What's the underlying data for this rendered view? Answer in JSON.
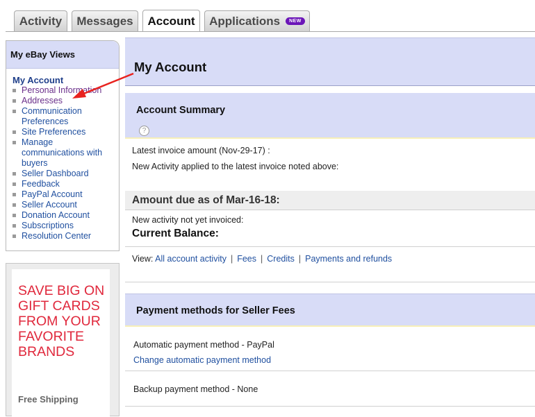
{
  "tabs": [
    {
      "label": "Activity"
    },
    {
      "label": "Messages"
    },
    {
      "label": "Account"
    },
    {
      "label": "Applications",
      "badge": "NEW"
    }
  ],
  "sidebar": {
    "title": "My eBay Views",
    "section": "My Account",
    "items": [
      {
        "label": "Personal Information"
      },
      {
        "label": "Addresses"
      },
      {
        "label": "Communication Preferences"
      },
      {
        "label": "Site Preferences"
      },
      {
        "label": "Manage communications with buyers"
      },
      {
        "label": "Seller Dashboard"
      },
      {
        "label": "Feedback"
      },
      {
        "label": "PayPal Account"
      },
      {
        "label": "Seller Account"
      },
      {
        "label": "Donation Account"
      },
      {
        "label": "Subscriptions"
      },
      {
        "label": "Resolution Center"
      }
    ]
  },
  "ad": {
    "headline": "SAVE BIG ON GIFT CARDS FROM YOUR FAVORITE BRANDS",
    "shipping": "Free Shipping"
  },
  "main": {
    "title": "My Account",
    "summary_title": "Account Summary",
    "help_icon": "?",
    "latest_invoice": "Latest invoice amount  (Nov-29-17) :",
    "new_activity_applied": "New Activity applied to the latest invoice noted above:",
    "amount_due": "Amount due as of Mar-16-18:",
    "not_invoiced": "New activity not yet invoiced:",
    "current_balance": "Current Balance:",
    "view_label": "View:",
    "view_links": [
      "All account activity",
      "Fees",
      "Credits",
      "Payments and refunds"
    ],
    "payment_title": "Payment methods for Seller Fees",
    "auto_method": "Automatic payment method - PayPal",
    "change_auto": "Change automatic payment method",
    "backup_method": "Backup payment method - None"
  },
  "colors": {
    "header_bg": "#d8dcf7",
    "link": "#1f4f9f",
    "ad_text": "#e0283c",
    "badge": "#6b15b8",
    "annotation_arrow": "#e8231f"
  }
}
